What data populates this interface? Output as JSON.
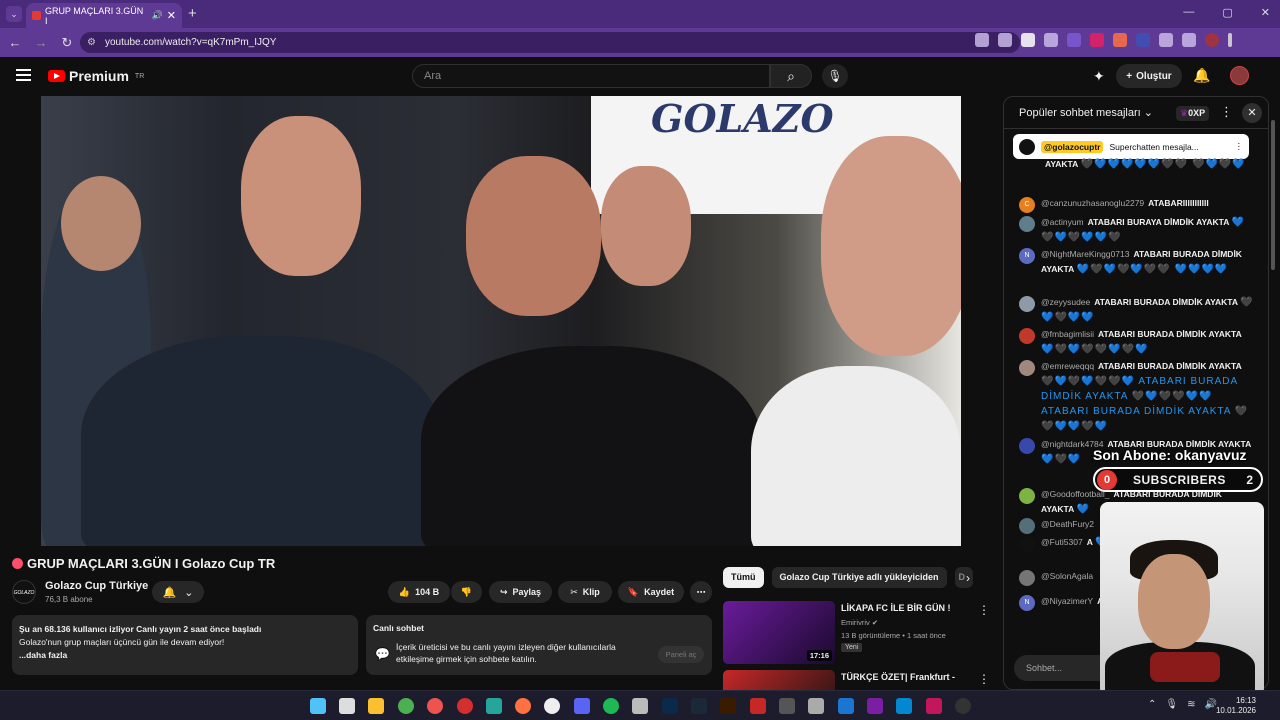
{
  "browser": {
    "tab_title": "GRUP MAÇLARI 3.GÜN I",
    "url": "youtube.com/watch?v=qK7mPm_IJQY",
    "tab_close": "✕",
    "new_tab": "+",
    "win_min": "—",
    "win_max": "▢",
    "win_close": "✕"
  },
  "header": {
    "logo_text": "Premium",
    "logo_sup": "TR",
    "search_placeholder": "Ara",
    "create_label": "Oluştur"
  },
  "video": {
    "banner_text": "GOLAZO",
    "title": "GRUP MAÇLARI 3.GÜN I Golazo Cup TR",
    "channel_name": "Golazo Cup Türkiye",
    "channel_avatar_text": "GOLAZO",
    "subscribers": "76,3 B abone",
    "likes": "104 B",
    "share_label": "Paylaş",
    "clip_label": "Klip",
    "save_label": "Kaydet"
  },
  "description": {
    "line1": "Şu an 68.136 kullanıcı izliyor  Canlı yayın 2 saat önce başladı",
    "line2": "Golazo'nun grup maçları üçüncü gün ile devam ediyor!",
    "more": "...daha fazla"
  },
  "live_chat_box": {
    "title": "Canlı sohbet",
    "body": "İçerik üreticisi ve bu canlı yayını izleyen diğer kullanıcılarla etkileşime girmek için sohbete katılın.",
    "open_button": "Paneli aç"
  },
  "chips": [
    "Tümü",
    "Golazo Cup Türkiye adlı yükleyiciden",
    "D"
  ],
  "related": [
    {
      "title": "LİKAPA FC İLE BİR GÜN !",
      "channel": "Emirivriv",
      "meta": "13 B görüntüleme • 1 saat önce",
      "badge": "Yeni",
      "duration": "17:16"
    },
    {
      "title": "TÜRKÇE ÖZET| Frankfurt -",
      "channel": "",
      "meta": "",
      "badge": "",
      "duration": ""
    }
  ],
  "chat": {
    "header": "Popüler sohbet mesajları",
    "xp": "0XP",
    "pinned_user": "@golazocuptr",
    "pinned_text": "Superchatten mesajla...",
    "input_placeholder": "Sohbet...",
    "messages": [
      {
        "user": "",
        "text": "AYAKTA",
        "hearts": "🖤💙💙💙💙💙🖤🖤\n🖤💙🖤💙",
        "avatar_letter": "",
        "avatar_color": "#555"
      },
      {
        "user": "@canzunuzhasanoglu2279",
        "text": "ATABARIIIIIIIIIII",
        "hearts": "",
        "avatar_letter": "C",
        "avatar_color": "#e67e22"
      },
      {
        "user": "@actinyum",
        "text": "ATABARI BURAYA DİMDİK AYAKTA",
        "hearts": "💙🖤💙🖤💙💙🖤",
        "avatar_letter": "",
        "avatar_color": "#607d8b"
      },
      {
        "user": "@NightMareKingg0713",
        "text": "ATABARI BURADA DİMDİK AYAKTA",
        "hearts": "💙🖤💙🖤💙🖤🖤\n💙💙💙💙",
        "avatar_letter": "N",
        "avatar_color": "#5c6bc0"
      },
      {
        "user": "@zeyysudee",
        "text": "ATABARI BURADA DİMDİK AYAKTA",
        "hearts": "🖤💙🖤💙💙",
        "avatar_letter": "",
        "avatar_color": "#8d9ba8"
      },
      {
        "user": "@fmbagimlisii",
        "text": "ATABARI BURADA DİMDİK AYAKTA",
        "hearts": "💙🖤💙🖤🖤💙🖤💙",
        "avatar_letter": "",
        "avatar_color": "#c0392b"
      },
      {
        "user": "@emreweqqq",
        "text": "ATABARI BURADA DİMDİK AYAKTA",
        "hearts": "🖤💙🖤💙🖤🖤💙 ATABARI BURADA DİMDİK AYAKTA 🖤💙🖤🖤💙💙 ATABARI BURADA DİMDİK AYAKTA 🖤🖤💙💙🖤💙",
        "avatar_letter": "",
        "avatar_color": "#a1887f"
      },
      {
        "user": "@nightdark4784",
        "text": "ATABARI BURADA DİMDİK AYAKTA",
        "hearts": "💙🖤💙",
        "avatar_letter": "",
        "avatar_color": "#3949ab"
      },
      {
        "user": "@Goodoffootball_",
        "text": "ATABARI BURADA DİMDİK AYAKTA",
        "hearts": "💙",
        "avatar_letter": "",
        "avatar_color": "#7cb342"
      },
      {
        "user": "@DeathFury2",
        "text": "",
        "hearts": "",
        "avatar_letter": "",
        "avatar_color": "#546e7a"
      },
      {
        "user": "@Futi5307",
        "text": "A",
        "hearts": "💙🖤",
        "avatar_letter": "",
        "avatar_color": "#111"
      },
      {
        "user": "@SolonAgala",
        "text": "",
        "hearts": "",
        "avatar_letter": "",
        "avatar_color": "#757575"
      },
      {
        "user": "@NiyazimerY",
        "text": "AYAKK",
        "hearts": "💙💙",
        "avatar_letter": "N",
        "avatar_color": "#5c6bc0"
      }
    ]
  },
  "overlay": {
    "last_sub": "Son Abone: okanyavuz",
    "sub_count_left": "0",
    "sub_label": "SUBSCRIBERS",
    "sub_count_right": "2"
  },
  "taskbar": {
    "time": "16:13",
    "date": "10.01.2026"
  }
}
